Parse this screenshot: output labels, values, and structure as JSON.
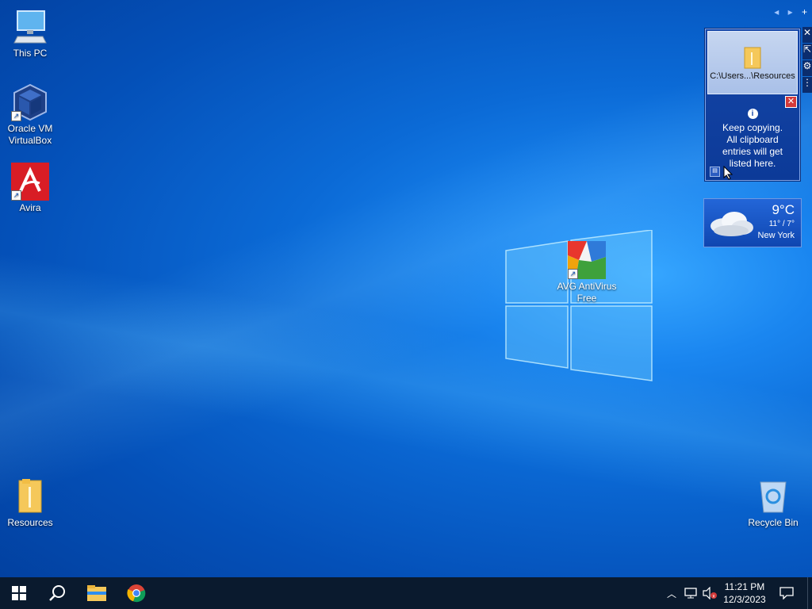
{
  "desktop": {
    "icons": [
      {
        "label": "This PC",
        "icon": "computer-icon"
      },
      {
        "label": "Oracle VM VirtualBox",
        "icon": "virtualbox-icon"
      },
      {
        "label": "Avira",
        "icon": "avira-icon"
      },
      {
        "label": "AVG AntiVirus Free",
        "icon": "avg-icon"
      },
      {
        "label": "Resources",
        "icon": "folder-icon"
      },
      {
        "label": "Recycle Bin",
        "icon": "recycle-bin-icon"
      }
    ]
  },
  "gadget_nav": {
    "prev": "◂",
    "next": "▸",
    "add": "+"
  },
  "clipboard_gadget": {
    "entry_path": "C:\\Users...\\Resources",
    "info_lines": [
      "Keep copying.",
      "All clipboard",
      "entries will get",
      "listed here."
    ],
    "close_glyph": "✕"
  },
  "weather_gadget": {
    "temperature": "9°C",
    "range": "11° / 7°",
    "city": "New York",
    "icon": "cloud-icon"
  },
  "taskbar": {
    "time": "11:21 PM",
    "date": "12/3/2023",
    "pinned": [
      "start-icon",
      "search-icon",
      "file-explorer-icon",
      "chrome-icon"
    ],
    "tray": [
      "chevron-up-icon",
      "network-icon",
      "volume-muted-icon",
      "notification-icon"
    ]
  },
  "colors": {
    "taskbar": "#0a1a2e",
    "wallpaper_accent": "#1a86f0",
    "gadget_bg": "#1546a8"
  }
}
